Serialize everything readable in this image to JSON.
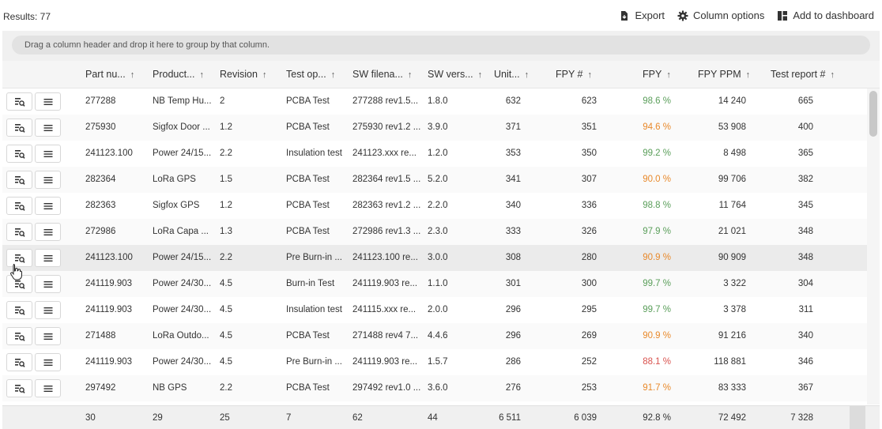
{
  "results_label": "Results: 77",
  "toolbar": {
    "export_label": "Export",
    "column_options_label": "Column options",
    "add_dashboard_label": "Add to dashboard"
  },
  "group_panel_text": "Drag a column header and drop it here to group by that column.",
  "columns": [
    "Part nu...",
    "Product...",
    "Revision",
    "Test op...",
    "SW filena...",
    "SW vers...",
    "Unit...",
    "FPY #",
    "FPY",
    "FPY PPM",
    "Test report #"
  ],
  "sort_arrow": "↑",
  "colors": {
    "good": "#5a9e5a",
    "warn": "#e8892b",
    "bad": "#d9534f"
  },
  "rows": [
    {
      "part": "277288",
      "product": "NB Temp Hu...",
      "revision": "2",
      "test_op": "PCBA Test",
      "sw_file": "277288 rev1.5...",
      "sw_ver": "1.8.0",
      "units": "632",
      "fpy_count": "623",
      "fpy": "98.6 %",
      "fpy_status": "good",
      "ppm": "14 240",
      "report": "665"
    },
    {
      "part": "275930",
      "product": "Sigfox Door ...",
      "revision": "1.2",
      "test_op": "PCBA Test",
      "sw_file": "275930 rev1.2 ...",
      "sw_ver": "3.9.0",
      "units": "371",
      "fpy_count": "351",
      "fpy": "94.6 %",
      "fpy_status": "warn",
      "ppm": "53 908",
      "report": "400"
    },
    {
      "part": "241123.100",
      "product": "Power 24/15...",
      "revision": "2.2",
      "test_op": "Insulation test",
      "sw_file": "241123.xxx re...",
      "sw_ver": "1.2.0",
      "units": "353",
      "fpy_count": "350",
      "fpy": "99.2 %",
      "fpy_status": "good",
      "ppm": "8 498",
      "report": "365"
    },
    {
      "part": "282364",
      "product": "LoRa GPS",
      "revision": "1.5",
      "test_op": "PCBA Test",
      "sw_file": "282364 rev1.5 ...",
      "sw_ver": "5.2.0",
      "units": "341",
      "fpy_count": "307",
      "fpy": "90.0 %",
      "fpy_status": "warn",
      "ppm": "99 706",
      "report": "382"
    },
    {
      "part": "282363",
      "product": "Sigfox GPS",
      "revision": "1.2",
      "test_op": "PCBA Test",
      "sw_file": "282363 rev1.2 ...",
      "sw_ver": "2.2.0",
      "units": "340",
      "fpy_count": "336",
      "fpy": "98.8 %",
      "fpy_status": "good",
      "ppm": "11 764",
      "report": "345"
    },
    {
      "part": "272986",
      "product": "LoRa Capa ...",
      "revision": "1.3",
      "test_op": "PCBA Test",
      "sw_file": "272986 rev1.3 ...",
      "sw_ver": "2.3.0",
      "units": "333",
      "fpy_count": "326",
      "fpy": "97.9 %",
      "fpy_status": "good",
      "ppm": "21 021",
      "report": "348"
    },
    {
      "part": "241123.100",
      "product": "Power 24/15...",
      "revision": "2.2",
      "test_op": "Pre Burn-in ...",
      "sw_file": "241123.100 re...",
      "sw_ver": "3.0.0",
      "units": "308",
      "fpy_count": "280",
      "fpy": "90.9 %",
      "fpy_status": "warn",
      "ppm": "90 909",
      "report": "348"
    },
    {
      "part": "241119.903",
      "product": "Power 24/30...",
      "revision": "4.5",
      "test_op": "Burn-in Test",
      "sw_file": "241119.903 re...",
      "sw_ver": "1.1.0",
      "units": "301",
      "fpy_count": "300",
      "fpy": "99.7 %",
      "fpy_status": "good",
      "ppm": "3 322",
      "report": "304"
    },
    {
      "part": "241119.903",
      "product": "Power 24/30...",
      "revision": "4.5",
      "test_op": "Insulation test",
      "sw_file": "241115.xxx re...",
      "sw_ver": "2.0.0",
      "units": "296",
      "fpy_count": "295",
      "fpy": "99.7 %",
      "fpy_status": "good",
      "ppm": "3 378",
      "report": "311"
    },
    {
      "part": "271488",
      "product": "LoRa Outdo...",
      "revision": "4.5",
      "test_op": "PCBA Test",
      "sw_file": "271488 rev4 7...",
      "sw_ver": "4.4.6",
      "units": "296",
      "fpy_count": "269",
      "fpy": "90.9 %",
      "fpy_status": "warn",
      "ppm": "91 216",
      "report": "340"
    },
    {
      "part": "241119.903",
      "product": "Power 24/30...",
      "revision": "4.5",
      "test_op": "Pre Burn-in ...",
      "sw_file": "241119.903 re...",
      "sw_ver": "1.5.7",
      "units": "286",
      "fpy_count": "252",
      "fpy": "88.1 %",
      "fpy_status": "bad",
      "ppm": "118 881",
      "report": "346"
    },
    {
      "part": "297492",
      "product": "NB GPS",
      "revision": "2.2",
      "test_op": "PCBA Test",
      "sw_file": "297492 rev1.0 ...",
      "sw_ver": "3.6.0",
      "units": "276",
      "fpy_count": "253",
      "fpy": "91.7 %",
      "fpy_status": "warn",
      "ppm": "83 333",
      "report": "367"
    }
  ],
  "hovered_row": 6,
  "totals": [
    "30",
    "29",
    "25",
    "7",
    "62",
    "44",
    "6 511",
    "6 039",
    "92.8 %",
    "72 492",
    "7 328"
  ]
}
